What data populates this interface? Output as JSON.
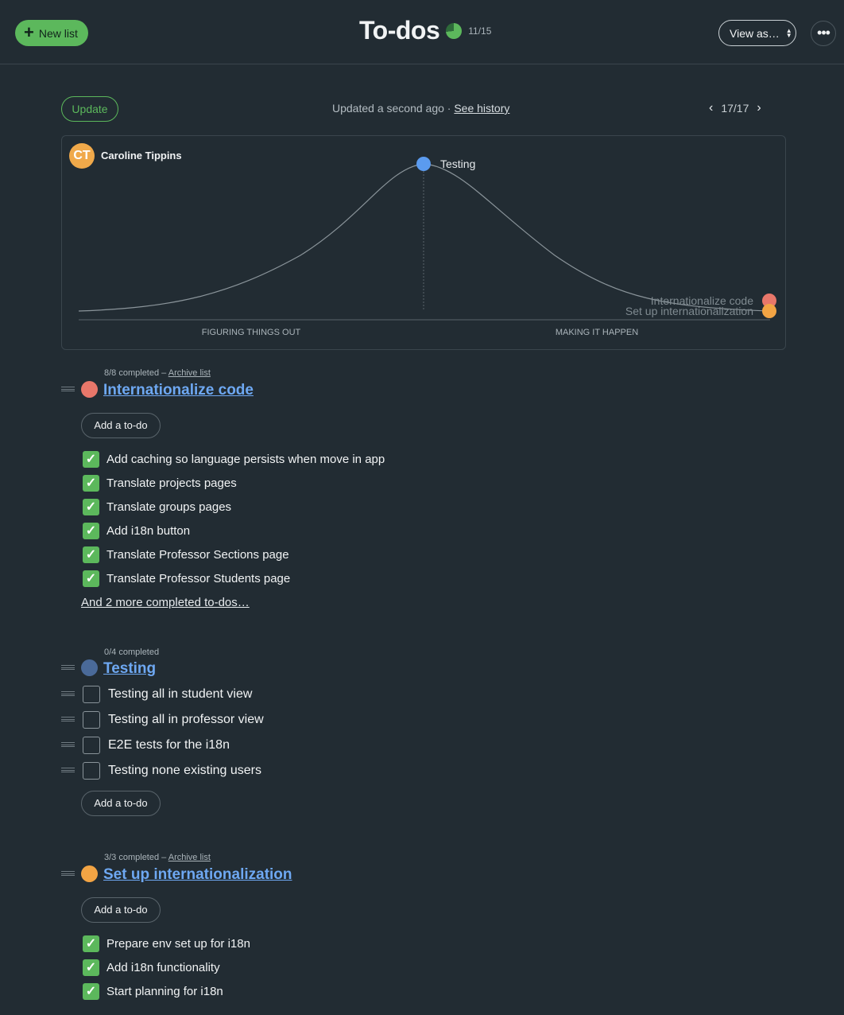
{
  "header": {
    "new_list_label": "New list",
    "title": "To-dos",
    "progress_text": "11/15",
    "progress_fraction": 0.7333,
    "view_as_label": "View as…",
    "more_label": "•••"
  },
  "status": {
    "update_label": "Update",
    "updated_text": "Updated a second ago · ",
    "history_link": "See history",
    "pager_text": "17/17"
  },
  "hill_chart": {
    "user_initials": "CT",
    "user_name": "Caroline Tippins",
    "axis_left_label": "FIGURING THINGS OUT",
    "axis_right_label": "MAKING IT HAPPEN",
    "dots": [
      {
        "label": "Testing",
        "color": "#5b9bef"
      },
      {
        "label": "Internationalize code",
        "color": "#e8776a"
      },
      {
        "label": "Set up internationalization",
        "color": "#f2a444"
      }
    ]
  },
  "lists": [
    {
      "meta": "8/8 completed – ",
      "archive_link": "Archive list",
      "title": "Internationalize code",
      "color": "#e8776a",
      "add_label": "Add a to-do",
      "todos": [
        "Add caching so language persists when move in app",
        "Translate projects pages",
        "Translate groups pages",
        "Add i18n button",
        "Translate Professor Sections page",
        "Translate Professor Students page"
      ],
      "more_completed": "And 2 more completed to-dos…"
    },
    {
      "meta": "0/4 completed",
      "title": "Testing",
      "color": "#4a6a99",
      "add_label": "Add a to-do",
      "todos": [
        "Testing all in student view",
        "Testing all in professor view",
        "E2E tests for the i18n",
        "Testing none existing users"
      ]
    },
    {
      "meta": "3/3 completed – ",
      "archive_link": "Archive list",
      "title": "Set up internationalization",
      "color": "#f2a444",
      "add_label": "Add a to-do",
      "todos": [
        "Prepare env set up for i18n",
        "Add i18n functionality",
        "Start planning for i18n"
      ]
    }
  ],
  "check_glyph": "✓"
}
